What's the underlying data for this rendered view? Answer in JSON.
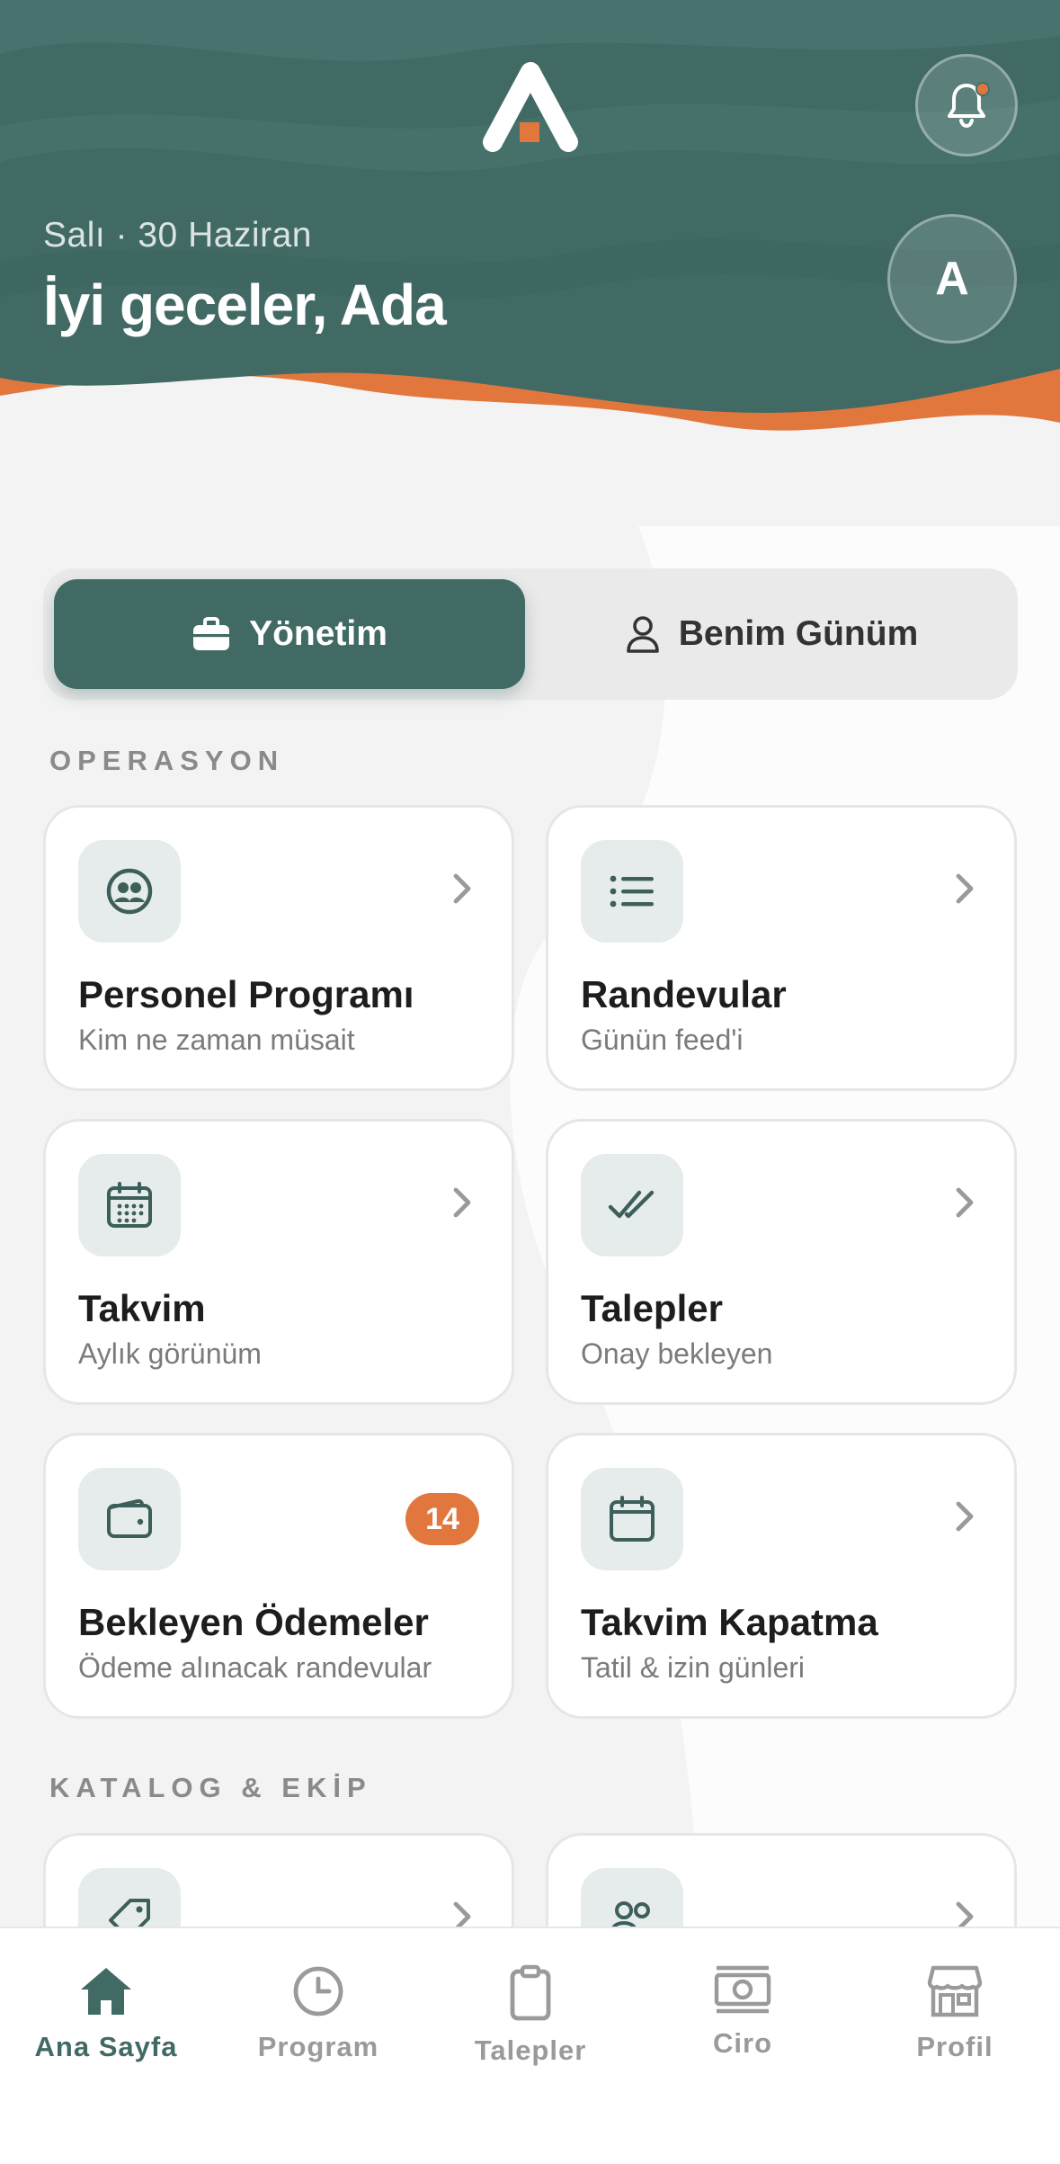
{
  "header": {
    "date": "Salı · 30 Haziran",
    "greeting": "İyi geceler, Ada",
    "avatar_initial": "A"
  },
  "segmented": {
    "active_label": "Yönetim",
    "inactive_label": "Benim Günüm"
  },
  "sections": {
    "operations_title": "OPERASYON",
    "catalog_title": "KATALOG & EKİP"
  },
  "cards": [
    {
      "title": "Personel Programı",
      "subtitle": "Kim ne zaman müsait",
      "icon": "team-icon"
    },
    {
      "title": "Randevular",
      "subtitle": "Günün feed'i",
      "icon": "list-icon"
    },
    {
      "title": "Takvim",
      "subtitle": "Aylık görünüm",
      "icon": "calendar-grid-icon"
    },
    {
      "title": "Talepler",
      "subtitle": "Onay bekleyen",
      "icon": "double-check-icon"
    },
    {
      "title": "Bekleyen Ödemeler",
      "subtitle": "Ödeme alınacak randevular",
      "icon": "wallet-icon",
      "badge": "14"
    },
    {
      "title": "Takvim Kapatma",
      "subtitle": "Tatil & izin günleri",
      "icon": "calendar-icon"
    }
  ],
  "tabbar": {
    "items": [
      {
        "label": "Ana Sayfa",
        "icon": "home-icon",
        "active": true
      },
      {
        "label": "Program",
        "icon": "clock-icon"
      },
      {
        "label": "Talepler",
        "icon": "clipboard-icon"
      },
      {
        "label": "Ciro",
        "icon": "cash-icon"
      },
      {
        "label": "Profil",
        "icon": "store-icon"
      }
    ]
  },
  "colors": {
    "primary": "#416a65",
    "accent": "#e2773d",
    "background": "#f3f3f3"
  }
}
